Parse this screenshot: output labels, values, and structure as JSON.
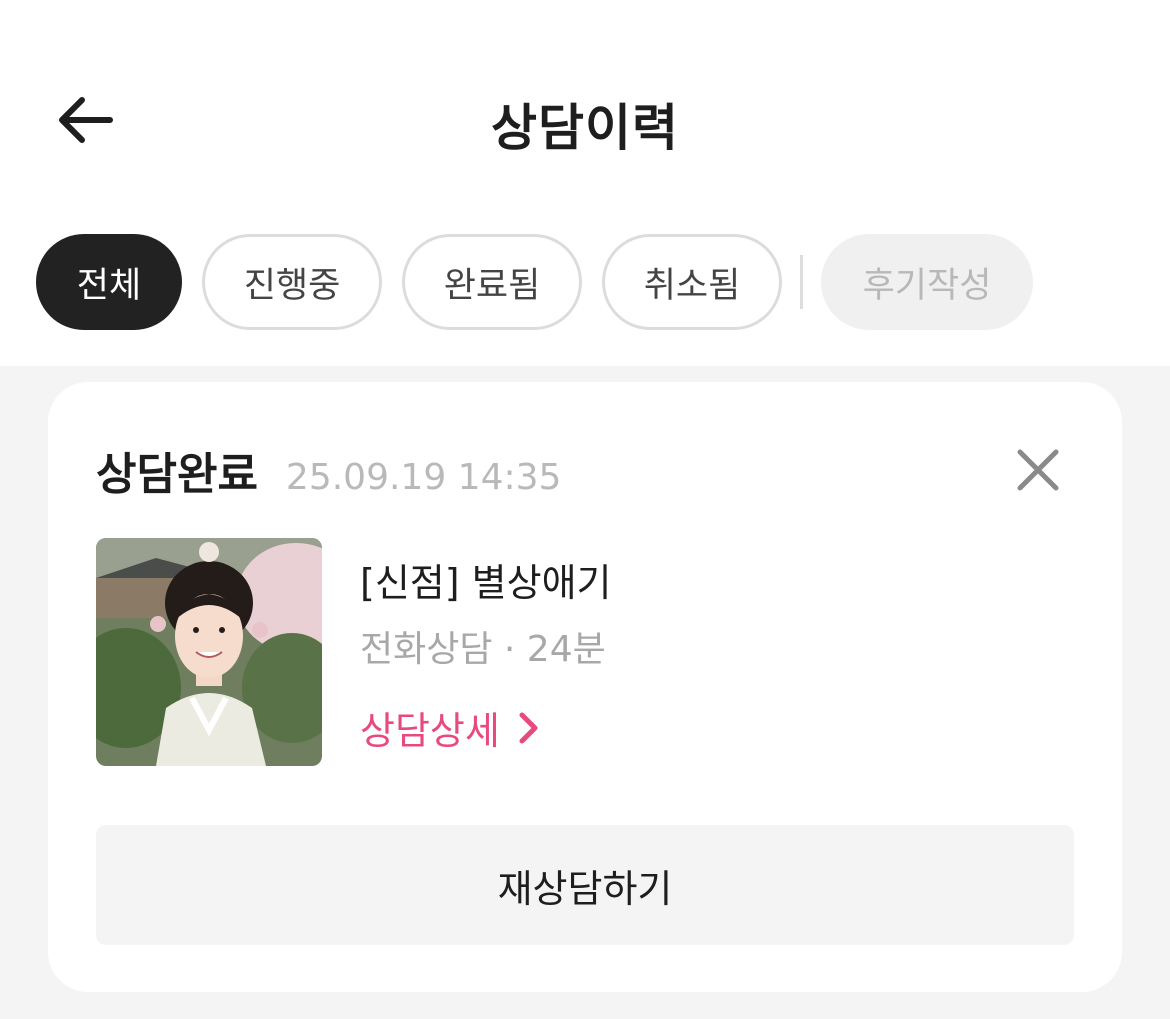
{
  "header": {
    "title": "상담이력",
    "back_icon": "arrow-left-icon"
  },
  "tabs": [
    {
      "label": "전체",
      "selected": true
    },
    {
      "label": "진행중",
      "selected": false
    },
    {
      "label": "완료됨",
      "selected": false
    },
    {
      "label": "취소됨",
      "selected": false
    },
    {
      "label": "후기작성",
      "selected": false,
      "disabled": true
    }
  ],
  "colors": {
    "accent": "#e84a7f",
    "selected_tab_bg": "#222222",
    "list_bg": "#f4f4f4"
  },
  "history": [
    {
      "status": "상담완료",
      "datetime": "25.09.19 14:35",
      "counselor_name": "[신점] 별상애기",
      "consult_info": "전화상담 · 24분",
      "detail_label": "상담상세",
      "recounsel_label": "재상담하기",
      "thumbnail_icon": "counselor-photo"
    }
  ]
}
